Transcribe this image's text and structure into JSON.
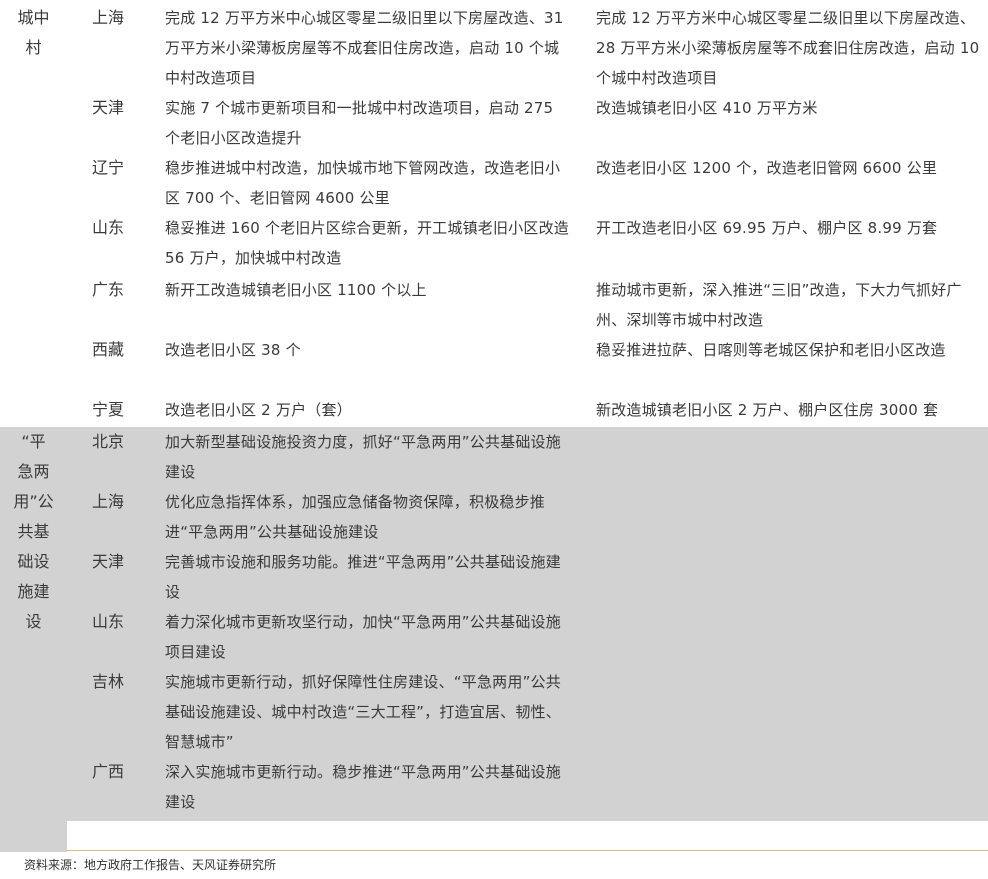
{
  "sections": [
    {
      "category": "城中\n村",
      "rows": [
        {
          "province": "上海",
          "col1": "完成 12 万平方米中心城区零星二级旧里以下房屋改造、31 万平方米小梁薄板房屋等不成套旧住房改造，启动 10 个城中村改造项目",
          "col2": "完成 12 万平方米中心城区零星二级旧里以下房屋改造、28 万平方米小梁薄板房屋等不成套旧住房改造，启动 10 个城中村改造项目"
        },
        {
          "province": "天津",
          "col1": "实施 7 个城市更新项目和一批城中村改造项目，启动 275 个老旧小区改造提升",
          "col2": "改造城镇老旧小区 410 万平方米"
        },
        {
          "province": "辽宁",
          "col1": "稳步推进城中村改造，加快城市地下管网改造，改造老旧小区 700 个、老旧管网 4600 公里",
          "col2": "改造老旧小区 1200 个，改造老旧管网 6600 公里"
        },
        {
          "province": "山东",
          "col1": "稳妥推进 160 个老旧片区综合更新，开工城镇老旧小区改造 56 万户，加快城中村改造",
          "col2": "开工改造老旧小区 69.95 万户、棚户区 8.99 万套"
        },
        {
          "province": "广东",
          "col1": "新开工改造城镇老旧小区 1100 个以上",
          "col2": "推动城市更新，深入推进“三旧”改造，下大力气抓好广州、深圳等市城中村改造"
        },
        {
          "province": "西藏",
          "col1": "改造老旧小区 38 个",
          "col2": "稳妥推进拉萨、日喀则等老城区保护和老旧小区改造"
        },
        {
          "province": "宁夏",
          "col1": "改造老旧小区 2 万户（套）",
          "col2": "新改造城镇老旧小区 2 万户、棚户区住房 3000 套"
        }
      ]
    },
    {
      "category": "“平\n急两\n用”公\n共基\n础设\n施建\n设",
      "rows": [
        {
          "province": "北京",
          "col1": "加大新型基础设施投资力度，抓好“平急两用”公共基础设施建设",
          "col2": ""
        },
        {
          "province": "上海",
          "col1": "优化应急指挥体系，加强应急储备物资保障，积极稳步推进“平急两用”公共基础设施建设",
          "col2": ""
        },
        {
          "province": "天津",
          "col1": "完善城市设施和服务功能。推进“平急两用”公共基础设施建设",
          "col2": ""
        },
        {
          "province": "山东",
          "col1": "着力深化城市更新攻坚行动，加快“平急两用”公共基础设施项目建设",
          "col2": ""
        },
        {
          "province": "吉林",
          "col1": "实施城市更新行动，抓好保障性住房建设、“平急两用”公共基础设施建设、城中村改造“三大工程”，打造宜居、韧性、智慧城市”",
          "col2": ""
        },
        {
          "province": "广西",
          "col1": "深入实施城市更新行动。稳步推进“平急两用”公共基础设施建设",
          "col2": ""
        }
      ]
    }
  ],
  "source_note": "资料来源：地方政府工作报告、天风证券研究所",
  "colors": {
    "section2_bg": "#d2d2d2",
    "text": "#3a3a3a",
    "rule": "#e0b98a"
  }
}
